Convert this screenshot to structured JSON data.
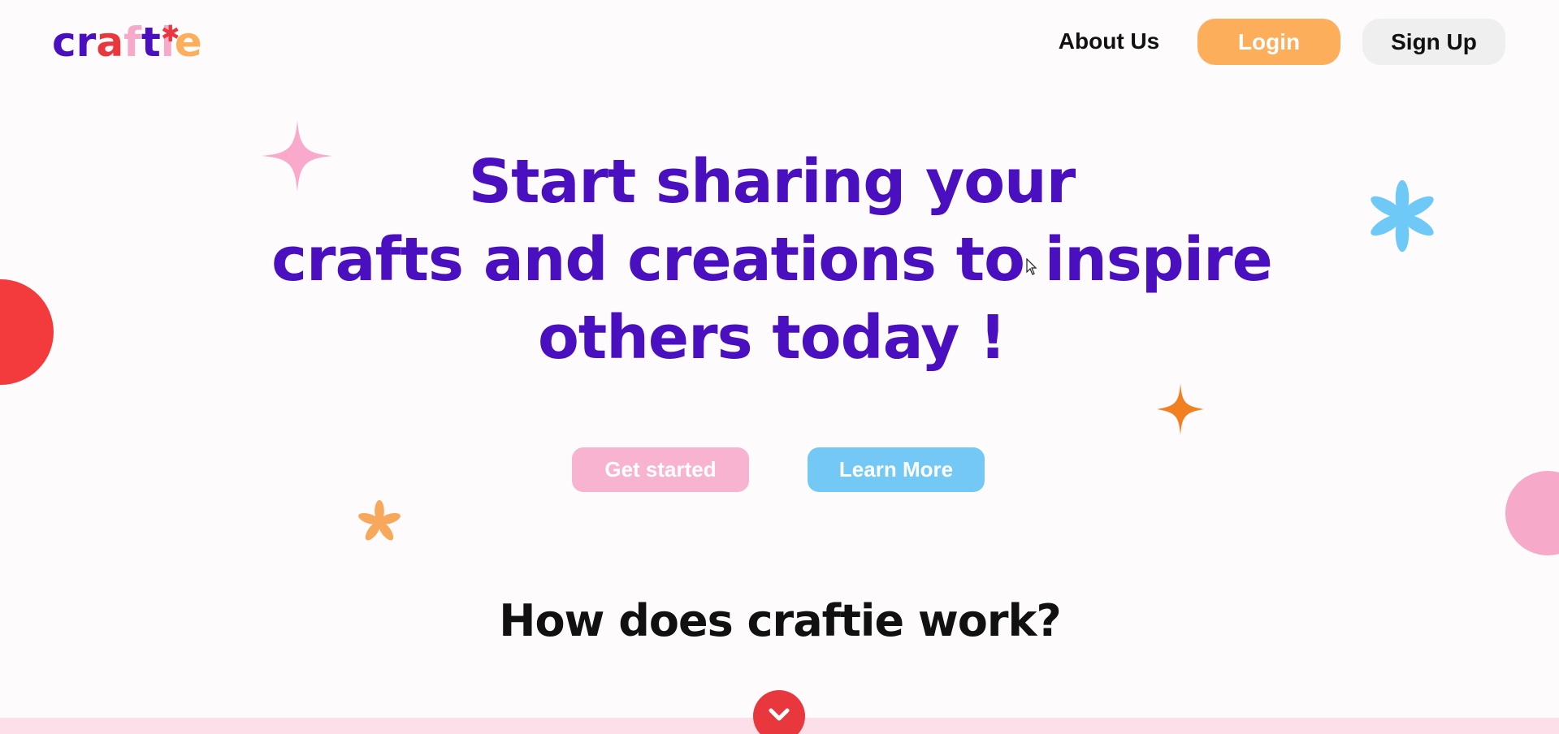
{
  "header": {
    "logo_letters": [
      "c",
      "r",
      "a",
      "f",
      "t",
      "i",
      "e"
    ],
    "logo_colors": [
      "#4a0fbf",
      "#4a0fbf",
      "#e8383d",
      "#f6a9c8",
      "#4a0fbf",
      "#f6a9c8",
      "#fdae5b"
    ],
    "nav": {
      "about_label": "About Us",
      "login_label": "Login",
      "signup_label": "Sign Up"
    }
  },
  "hero": {
    "title_lines": [
      "Start sharing your",
      "crafts and creations to inspire",
      "others today !"
    ],
    "get_started_label": "Get started",
    "learn_more_label": "Learn More"
  },
  "section": {
    "heading": "How does craftie work?"
  },
  "colors": {
    "primary": "#4a0fbf",
    "login_bg": "#fdae5b",
    "signup_bg": "#efefef",
    "get_started_bg": "#f8b3d1",
    "learn_more_bg": "#73c8f5",
    "accent_red": "#e8383d",
    "star_pink": "#f8a9cc",
    "star_orange": "#f08020",
    "flower_blue": "#6fc9f7",
    "flower_orange": "#f7a85a"
  },
  "decorations": {
    "icons": [
      "sparkle-icon",
      "flower-icon",
      "sparkle-icon",
      "flower-icon",
      "chevron-down-icon"
    ]
  }
}
